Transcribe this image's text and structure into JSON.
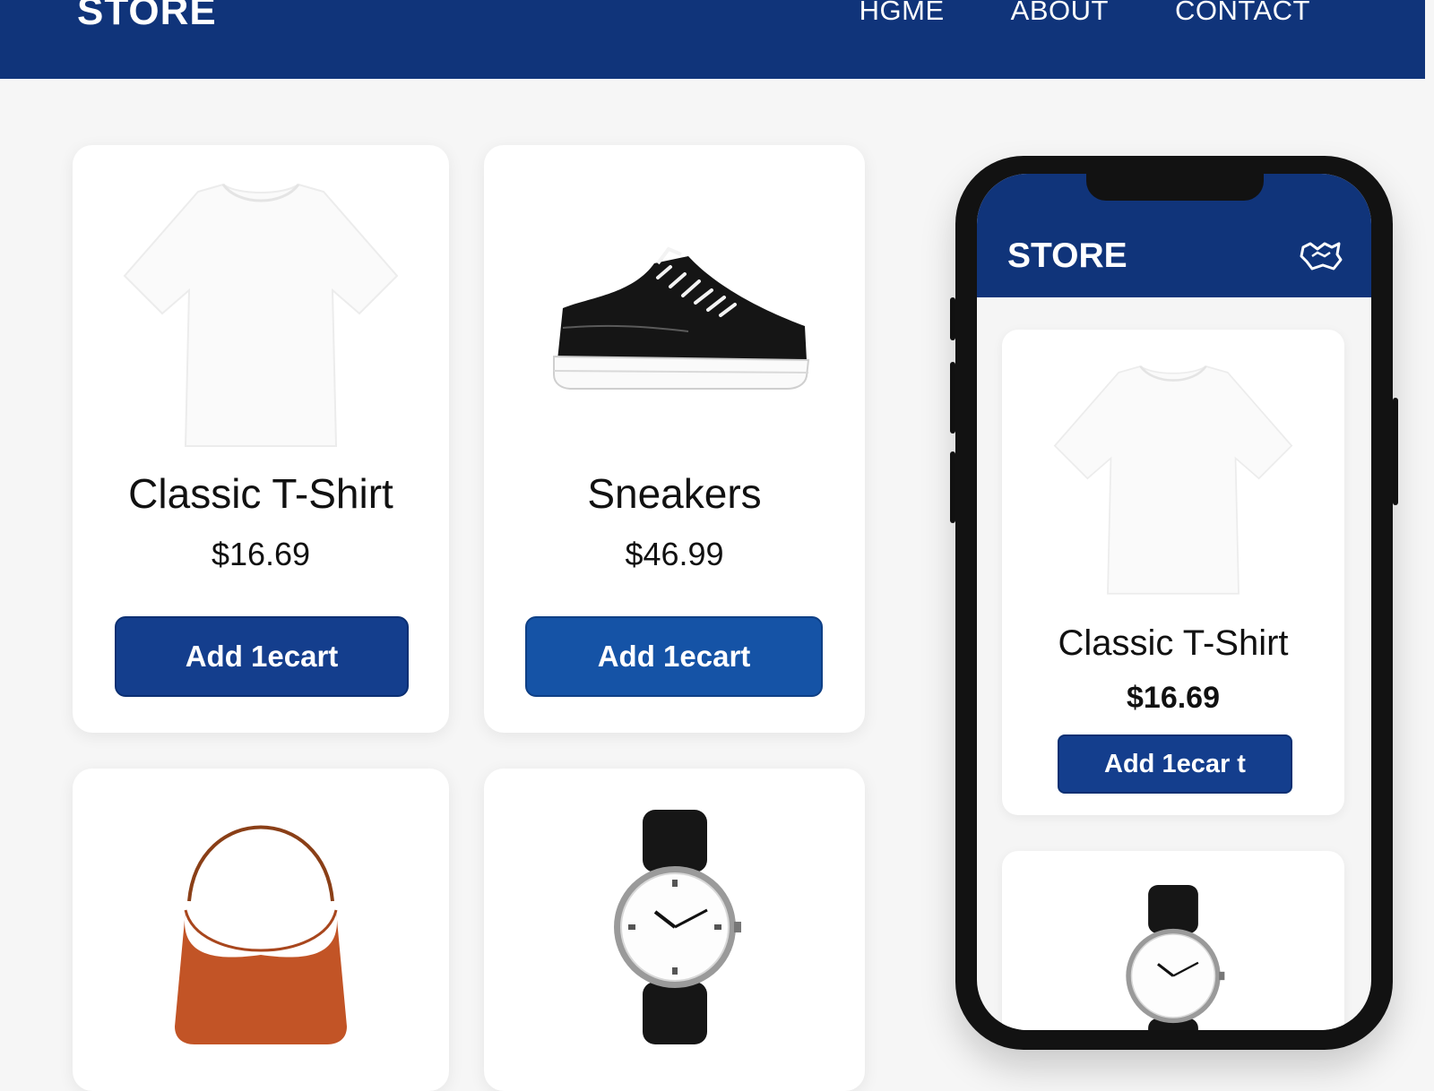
{
  "header": {
    "brand": "STORE",
    "nav": [
      "HGME",
      "ABOUT",
      "CONTACT"
    ],
    "bg_color": "#10347a"
  },
  "products": [
    {
      "name": "Classic T-Shirt",
      "price": "$16.69",
      "button": "Add 1ecart",
      "image": "white-tshirt"
    },
    {
      "name": "Sneakers",
      "price": "$46.99",
      "button": "Add 1ecart",
      "image": "black-sneaker"
    },
    {
      "name": "",
      "price": "",
      "button": "",
      "image": "orange-handbag"
    },
    {
      "name": "",
      "price": "",
      "button": "",
      "image": "black-wristwatch"
    }
  ],
  "mobile": {
    "brand": "STORE",
    "header_icon": "cart-icon",
    "product": {
      "name": "Classic T-Shirt",
      "price": "$16.69",
      "button": "Add 1ecar t",
      "image": "white-tshirt"
    },
    "next_product_image": "black-wristwatch"
  },
  "colors": {
    "primary": "#10347a",
    "button": "#143e8d",
    "background": "#f6f6f6",
    "card": "#ffffff"
  }
}
